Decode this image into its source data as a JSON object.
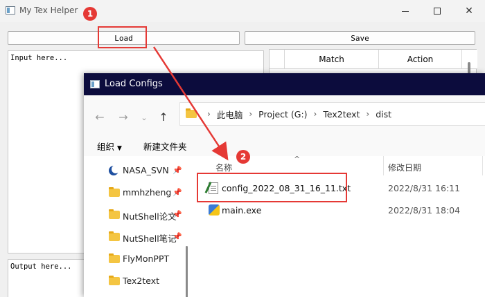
{
  "main_window": {
    "title": "My Tex Helper",
    "load_label": "Load",
    "save_label": "Save",
    "input_placeholder": "Input here...",
    "output_placeholder": "Output here...",
    "table_headers": {
      "match": "Match",
      "action": "Action"
    }
  },
  "annotations": {
    "step1": "1",
    "step2": "2",
    "accent_color": "#e53935"
  },
  "dialog": {
    "title": "Load Configs",
    "breadcrumb": [
      "此电脑",
      "Project (G:)",
      "Tex2text",
      "dist"
    ],
    "toolbar": {
      "organize": "组织",
      "new_folder": "新建文件夹"
    },
    "nav_items": [
      {
        "label": "NASA_SVN",
        "icon": "svn-icon",
        "pinned": true
      },
      {
        "label": "mmhzheng",
        "icon": "folder-icon",
        "pinned": true
      },
      {
        "label": "NutShell论文",
        "icon": "folder-icon",
        "pinned": true
      },
      {
        "label": "NutShell笔记",
        "icon": "folder-icon",
        "pinned": true
      },
      {
        "label": "FlyMonPPT",
        "icon": "folder-icon",
        "pinned": false
      },
      {
        "label": "Tex2text",
        "icon": "folder-icon",
        "pinned": false
      }
    ],
    "columns": {
      "name": "名称",
      "modified": "修改日期"
    },
    "files": [
      {
        "name": "config_2022_08_31_16_11.txt",
        "modified": "2022/8/31 16:11",
        "icon": "text-file-icon"
      },
      {
        "name": "main.exe",
        "modified": "2022/8/31 18:04",
        "icon": "exe-icon"
      }
    ],
    "title_bar_color": "#0c0c3d"
  }
}
